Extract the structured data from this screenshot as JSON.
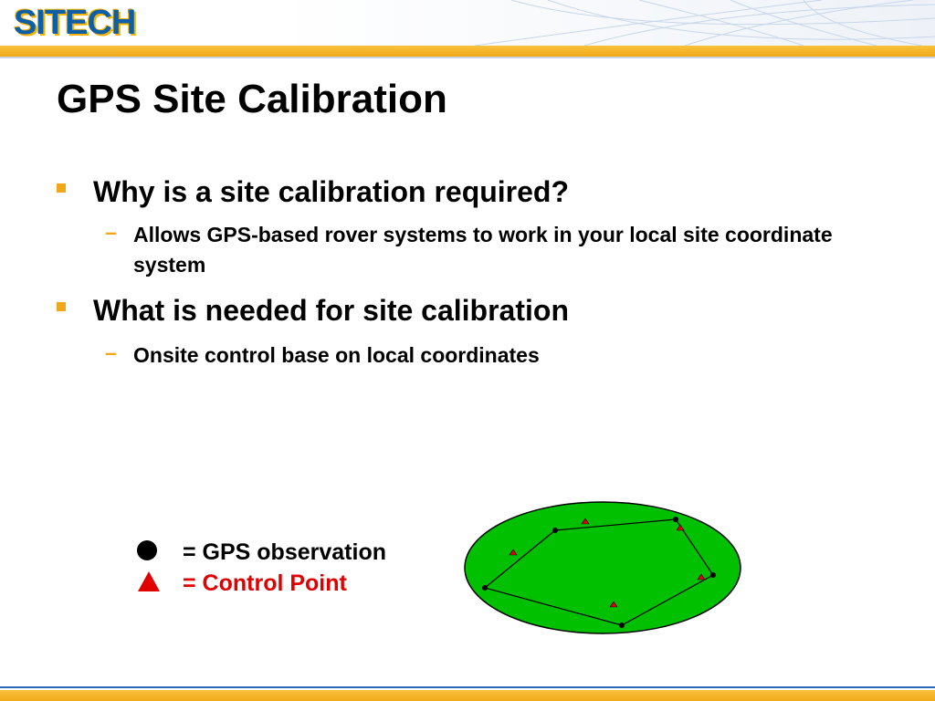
{
  "brand": {
    "logo_text": "SITECH",
    "trademark": "®"
  },
  "slide": {
    "title": "GPS Site Calibration",
    "bullets": [
      {
        "text": "Why is a site calibration required?",
        "sub": [
          "Allows GPS-based rover systems to work in your local site coordinate system"
        ]
      },
      {
        "text": "What is needed for site calibration",
        "sub": [
          "Onsite control base on local coordinates"
        ]
      }
    ],
    "sub_bullet_marker": "–"
  },
  "legend": {
    "gps_observation": "= GPS observation",
    "control_point": "= Control Point"
  },
  "colors": {
    "accent_orange": "#f0a81a",
    "brand_blue": "#0e5fa8",
    "field_green": "#00c000",
    "control_red": "#e00000",
    "bottom_line_blue": "#2a66b8"
  }
}
